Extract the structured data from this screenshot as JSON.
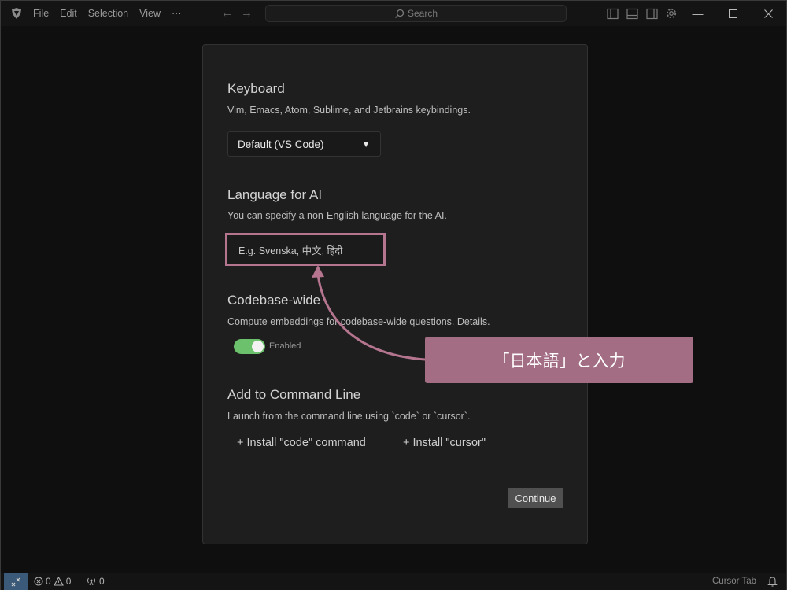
{
  "titlebar": {
    "menu": [
      "File",
      "Edit",
      "Selection",
      "View",
      "···"
    ],
    "search_placeholder": "Search"
  },
  "keyboard": {
    "title": "Keyboard",
    "description": "Vim, Emacs, Atom, Sublime, and Jetbrains keybindings.",
    "selected": "Default (VS Code)"
  },
  "language": {
    "title": "Language for AI",
    "description": "You can specify a non-English language for the AI.",
    "placeholder": "E.g. Svenska, 中文, हिंदी"
  },
  "codebase": {
    "title": "Codebase-wide",
    "description": "Compute embeddings for codebase-wide questions.",
    "details_link": "Details.",
    "toggle_label": "Enabled",
    "toggle_on": true
  },
  "command_line": {
    "title": "Add to Command Line",
    "description": "Launch from the command line using `code` or `cursor`.",
    "install_code": "+ Install \"code\" command",
    "install_cursor": "+ Install \"cursor\""
  },
  "continue_label": "Continue",
  "annotation": {
    "callout_text": "「日本語」と入力",
    "color": "#a36d84"
  },
  "statusbar": {
    "errors": "0",
    "warnings": "0",
    "ports": "0",
    "cursor_tab": "Cursor Tab"
  }
}
